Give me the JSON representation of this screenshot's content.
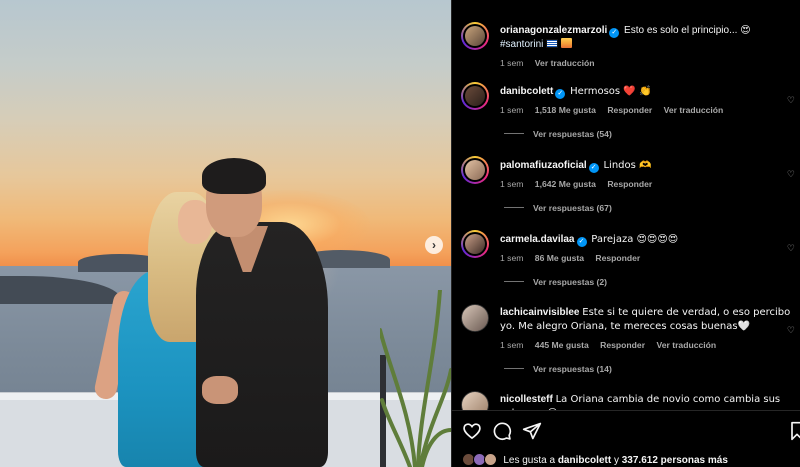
{
  "photo": {
    "next_icon": "chevron-right-icon",
    "next_glyph": "›"
  },
  "post": {
    "author": "orianagonzalezmarzoli",
    "caption": "Esto es solo el principio... 😍",
    "hashtag": "#santorini",
    "time": "1 sem",
    "translate": "Ver traducción"
  },
  "comments": [
    {
      "user": "danibcolett",
      "verified": true,
      "text": "Hermosos ❤️ 👏",
      "time": "1 sem",
      "likes": "1,518 Me gusta",
      "reply": "Responder",
      "translate": "Ver traducción",
      "replies": "Ver respuestas (54)"
    },
    {
      "user": "palomafiuzaoficial",
      "verified": true,
      "text": "Lindos 🫶",
      "time": "1 sem",
      "likes": "1,642 Me gusta",
      "reply": "Responder",
      "replies": "Ver respuestas (67)"
    },
    {
      "user": "carmela.davilaa",
      "verified": true,
      "text": "Parejaza 😍😍😍😍",
      "time": "1 sem",
      "likes": "86 Me gusta",
      "reply": "Responder",
      "replies": "Ver respuestas (2)"
    },
    {
      "user": "lachicainvisiblee",
      "verified": false,
      "text": "Este si te quiere de verdad, o eso percibo yo. Me alegro Oriana, te mereces cosas buenas🤍",
      "time": "1 sem",
      "likes": "445 Me gusta",
      "reply": "Responder",
      "translate": "Ver traducción",
      "replies": "Ver respuestas (14)"
    },
    {
      "user": "nicollesteff",
      "verified": false,
      "text": "La Oriana cambia de novio como cambia sus calzones 😂"
    }
  ],
  "actions": {
    "like_icon": "heart-icon",
    "comment_icon": "comment-icon",
    "share_icon": "send-icon",
    "save_icon": "bookmark-icon"
  },
  "likes_summary": {
    "prefix": "Les gusta a ",
    "user": "danibcolett",
    "middle": " y ",
    "count": "337.612 personas más"
  },
  "colors": {
    "background": "#000000",
    "text": "#f5f5f5",
    "muted": "#a8a8a8",
    "verified": "#0095f6",
    "divider": "#262626"
  }
}
